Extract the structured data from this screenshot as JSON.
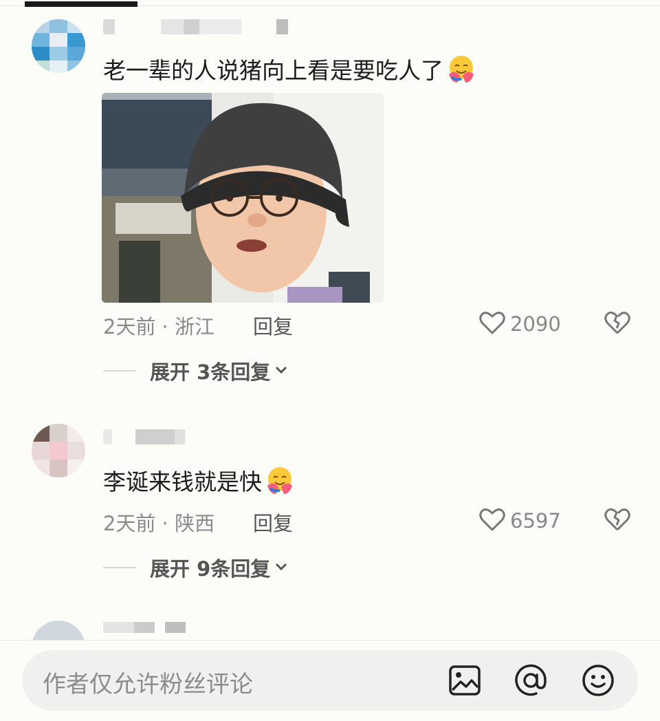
{
  "comments": [
    {
      "text": "老一辈的人说猪向上看是要吃人了",
      "emoji": "hugging-face-emoji",
      "time_location": "2天前 · 浙江",
      "reply_label": "回复",
      "likes": "2090",
      "expand_label": "展开 3条回复"
    },
    {
      "text": "李诞来钱就是快",
      "emoji": "hugging-face-emoji",
      "time_location": "2天前 · 陕西",
      "reply_label": "回复",
      "likes": "6597",
      "expand_label": "展开 9条回复"
    }
  ],
  "input": {
    "placeholder": "作者仅允许粉丝评论",
    "icons": [
      "image-icon",
      "at-icon",
      "emoji-icon"
    ]
  },
  "colors": {
    "background": "#fcfcf8",
    "text": "#1c1c1c",
    "secondary_text": "#8a8a8a",
    "input_bg": "#f0f0ee"
  }
}
